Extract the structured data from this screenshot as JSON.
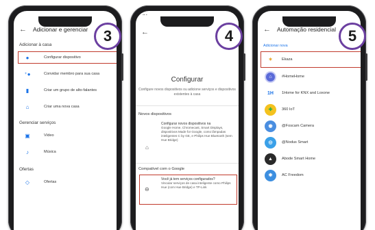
{
  "colors": {
    "badge_border": "#6b3fa0",
    "highlight": "#c0392b",
    "accent": "#1a73e8"
  },
  "screen1": {
    "step": "3",
    "title": "Adicionar e gerenciar",
    "section_add": "Adicionar à casa",
    "items_add": [
      {
        "icon": "gear-plus-icon",
        "label": "Configurar dispositivo"
      },
      {
        "icon": "person-add-icon",
        "label": "Convidar membro para sua casa"
      },
      {
        "icon": "speaker-group-icon",
        "label": "Criar um grupo de alto-falantes"
      },
      {
        "icon": "home-icon",
        "label": "Criar uma nova casa"
      }
    ],
    "section_services": "Gerenciar serviços",
    "items_services": [
      {
        "icon": "video-icon",
        "label": "Vídeo"
      },
      {
        "icon": "music-icon",
        "label": "Música"
      }
    ],
    "section_offers": "Ofertas",
    "items_offers": [
      {
        "icon": "tag-icon",
        "label": "Ofertas"
      }
    ]
  },
  "screen2": {
    "step": "4",
    "title": "Configurar",
    "subtitle": "Configure novos dispositivos ou adicione serviços e dispositivos existentes à casa",
    "section_new": "Novos dispositivos",
    "new_title": "Configurar novos dispositivos na",
    "new_desc": "Google Home, Chromecast, Smart Displays, dispositivos Made for Google, como lâmpadas inteligentes C by GE, e Philips Hue Bluetooth (sem Hue Bridge)",
    "section_works": "Compatível com o Google",
    "works_title": "Você já tem serviços configurados?",
    "works_desc": "Vincular serviços de casa inteligente como Philips Hue (com Hue Bridge) e TP-Link"
  },
  "screen3": {
    "step": "5",
    "title": "Automação residencial",
    "section": "Adicionar nova",
    "services": [
      {
        "name": "Ekaza",
        "logo": "ekaza-logo-icon",
        "color": "#ffffff"
      },
      {
        "name": "#HomeHome",
        "logo": "homehome-logo-icon",
        "color": "#5a6ad8"
      },
      {
        "name": "1Home for KNX and Loxone",
        "logo": "1home-logo-icon",
        "color": "#ffffff"
      },
      {
        "name": "360 IoT",
        "logo": "360iot-logo-icon",
        "color": "#2cae4a"
      },
      {
        "name": "@Foscam Camera",
        "logo": "foscam-logo-icon",
        "color": "#4a8ee0"
      },
      {
        "name": "@Nodus Smart",
        "logo": "nodus-logo-icon",
        "color": "#3aa0e8"
      },
      {
        "name": "Abode Smart Home",
        "logo": "abode-logo-icon",
        "color": "#2a2a2a"
      },
      {
        "name": "AC Freedom",
        "logo": "acfreedom-logo-icon",
        "color": "#3d8fe0"
      }
    ]
  }
}
